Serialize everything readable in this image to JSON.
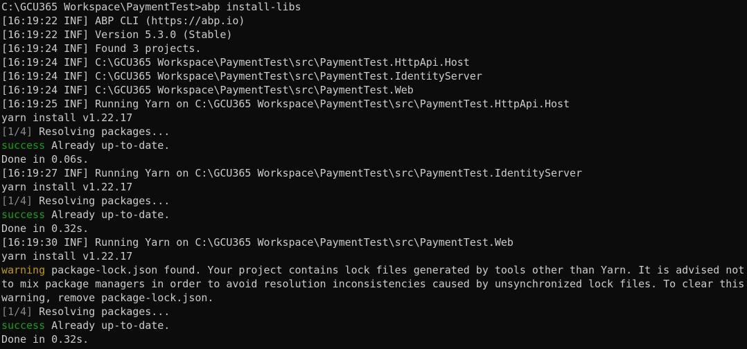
{
  "colors": {
    "background": "#0c0c0c",
    "default": "#cccccc",
    "dim": "#8a8a8a",
    "success": "#13a10e",
    "warning": "#c19c00"
  },
  "terminal": {
    "lines": [
      [
        {
          "t": "C:\\GCU365 Workspace\\PaymentTest>abp install-libs",
          "c": "default"
        }
      ],
      [
        {
          "t": "[16:19:22 INF] ",
          "c": "default"
        },
        {
          "t": "ABP CLI (https://abp.io)",
          "c": "default"
        }
      ],
      [
        {
          "t": "[16:19:22 INF] ",
          "c": "default"
        },
        {
          "t": "Version 5.3.0 (Stable)",
          "c": "default"
        }
      ],
      [
        {
          "t": "[16:19:24 INF] ",
          "c": "default"
        },
        {
          "t": "Found 3 projects.",
          "c": "default"
        }
      ],
      [
        {
          "t": "[16:19:24 INF] ",
          "c": "default"
        },
        {
          "t": "C:\\GCU365 Workspace\\PaymentTest\\src\\PaymentTest.HttpApi.Host",
          "c": "default"
        }
      ],
      [
        {
          "t": "[16:19:24 INF] ",
          "c": "default"
        },
        {
          "t": "C:\\GCU365 Workspace\\PaymentTest\\src\\PaymentTest.IdentityServer",
          "c": "default"
        }
      ],
      [
        {
          "t": "[16:19:24 INF] ",
          "c": "default"
        },
        {
          "t": "C:\\GCU365 Workspace\\PaymentTest\\src\\PaymentTest.Web",
          "c": "default"
        }
      ],
      [
        {
          "t": "[16:19:25 INF] ",
          "c": "default"
        },
        {
          "t": "Running Yarn on C:\\GCU365 Workspace\\PaymentTest\\src\\PaymentTest.HttpApi.Host",
          "c": "default"
        }
      ],
      [
        {
          "t": "yarn install v1.22.17",
          "c": "default"
        }
      ],
      [
        {
          "t": "[1/4]",
          "c": "dim"
        },
        {
          "t": " Resolving packages...",
          "c": "default"
        }
      ],
      [
        {
          "t": "success",
          "c": "success"
        },
        {
          "t": " Already up-to-date.",
          "c": "default"
        }
      ],
      [
        {
          "t": "Done in 0.06s.",
          "c": "default"
        }
      ],
      [
        {
          "t": "[16:19:27 INF] ",
          "c": "default"
        },
        {
          "t": "Running Yarn on C:\\GCU365 Workspace\\PaymentTest\\src\\PaymentTest.IdentityServer",
          "c": "default"
        }
      ],
      [
        {
          "t": "yarn install v1.22.17",
          "c": "default"
        }
      ],
      [
        {
          "t": "[1/4]",
          "c": "dim"
        },
        {
          "t": " Resolving packages...",
          "c": "default"
        }
      ],
      [
        {
          "t": "success",
          "c": "success"
        },
        {
          "t": " Already up-to-date.",
          "c": "default"
        }
      ],
      [
        {
          "t": "Done in 0.32s.",
          "c": "default"
        }
      ],
      [
        {
          "t": "[16:19:30 INF] ",
          "c": "default"
        },
        {
          "t": "Running Yarn on C:\\GCU365 Workspace\\PaymentTest\\src\\PaymentTest.Web",
          "c": "default"
        }
      ],
      [
        {
          "t": "yarn install v1.22.17",
          "c": "default"
        }
      ],
      [
        {
          "t": "warning",
          "c": "warning"
        },
        {
          "t": " package-lock.json found. Your project contains lock files generated by tools other than Yarn. It is advised not",
          "c": "default"
        }
      ],
      [
        {
          "t": "to mix package managers in order to avoid resolution inconsistencies caused by unsynchronized lock files. To clear this",
          "c": "default"
        }
      ],
      [
        {
          "t": "warning, remove package-lock.json.",
          "c": "default"
        }
      ],
      [
        {
          "t": "[1/4]",
          "c": "dim"
        },
        {
          "t": " Resolving packages...",
          "c": "default"
        }
      ],
      [
        {
          "t": "success",
          "c": "success"
        },
        {
          "t": " Already up-to-date.",
          "c": "default"
        }
      ],
      [
        {
          "t": "Done in 0.32s.",
          "c": "default"
        }
      ]
    ]
  }
}
